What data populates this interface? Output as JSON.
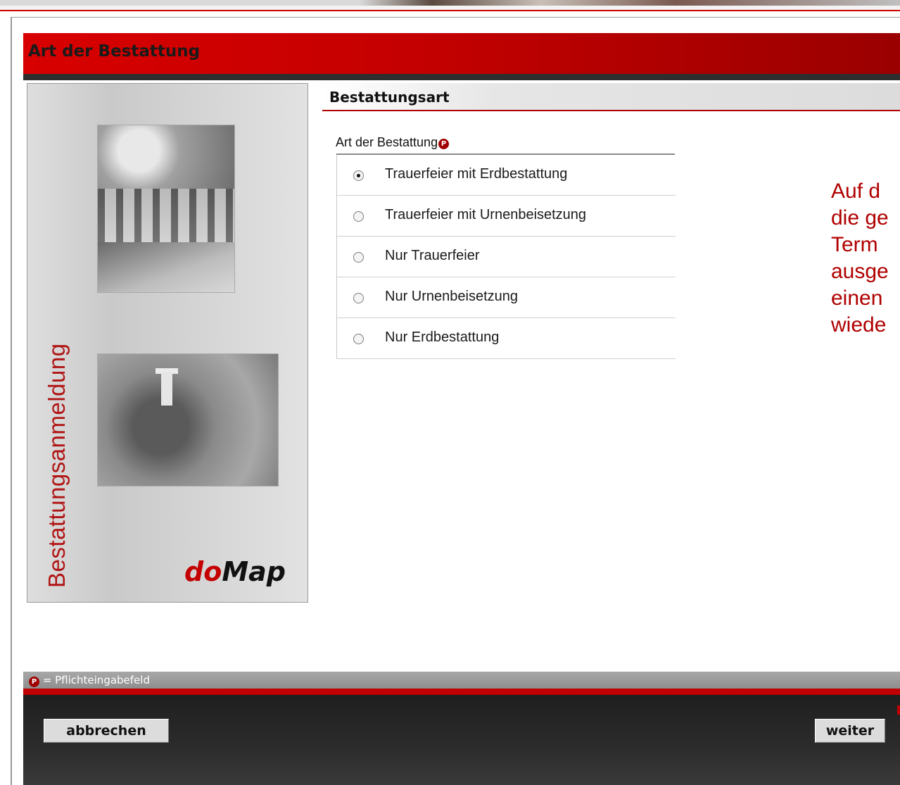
{
  "page": {
    "title": "Art der Bestattung"
  },
  "sidebar": {
    "vertical_title": "Bestattungsanmeldung",
    "logo": {
      "do": "do",
      "map": "Map"
    }
  },
  "section": {
    "heading": "Bestattungsart"
  },
  "form": {
    "group_label": "Art der Bestattung",
    "required_icon": "P",
    "options": [
      {
        "label": "Trauerfeier mit Erdbestattung",
        "checked": true
      },
      {
        "label": "Trauerfeier mit Urnenbeisetzung",
        "checked": false
      },
      {
        "label": "Nur Trauerfeier",
        "checked": false
      },
      {
        "label": "Nur Urnenbeisetzung",
        "checked": false
      },
      {
        "label": "Nur Erdbestattung",
        "checked": false
      }
    ],
    "selected": "Trauerfeier mit Erdbestattung"
  },
  "info_text": {
    "lines": [
      "Auf d",
      "die ge",
      "Term",
      "ausge",
      "einen",
      "wiede"
    ]
  },
  "legend": {
    "icon": "P",
    "text": "= Pflichteingabefeld"
  },
  "footer": {
    "cancel_label": "abbrechen",
    "next_label": "weiter"
  },
  "colors": {
    "brand_red": "#c40000",
    "dark": "#2b2b2b",
    "info_red": "#b00000"
  },
  "icons": {
    "required": "required-field-icon",
    "radio_checked": "radio-checked",
    "radio_unchecked": "radio-unchecked"
  }
}
